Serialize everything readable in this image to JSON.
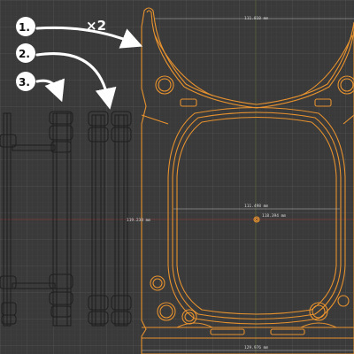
{
  "viewport": {
    "background": "#3a3a3a",
    "grid_minor": "#444444",
    "grid_major": "#4e4e4e",
    "selected_outline": "#e8922e",
    "ghost_outline": "#1e1e1e"
  },
  "annotations": {
    "step_1": "1.",
    "step_2": "2.",
    "step_3": "3.",
    "multiplier": "×2"
  },
  "dimensions": {
    "top_width": "111.810 mm",
    "inner_width": "111.498 mm",
    "left_height": "119.238 mm",
    "right_height": "118.394 mm",
    "bottom_width": "129.976 mm"
  }
}
